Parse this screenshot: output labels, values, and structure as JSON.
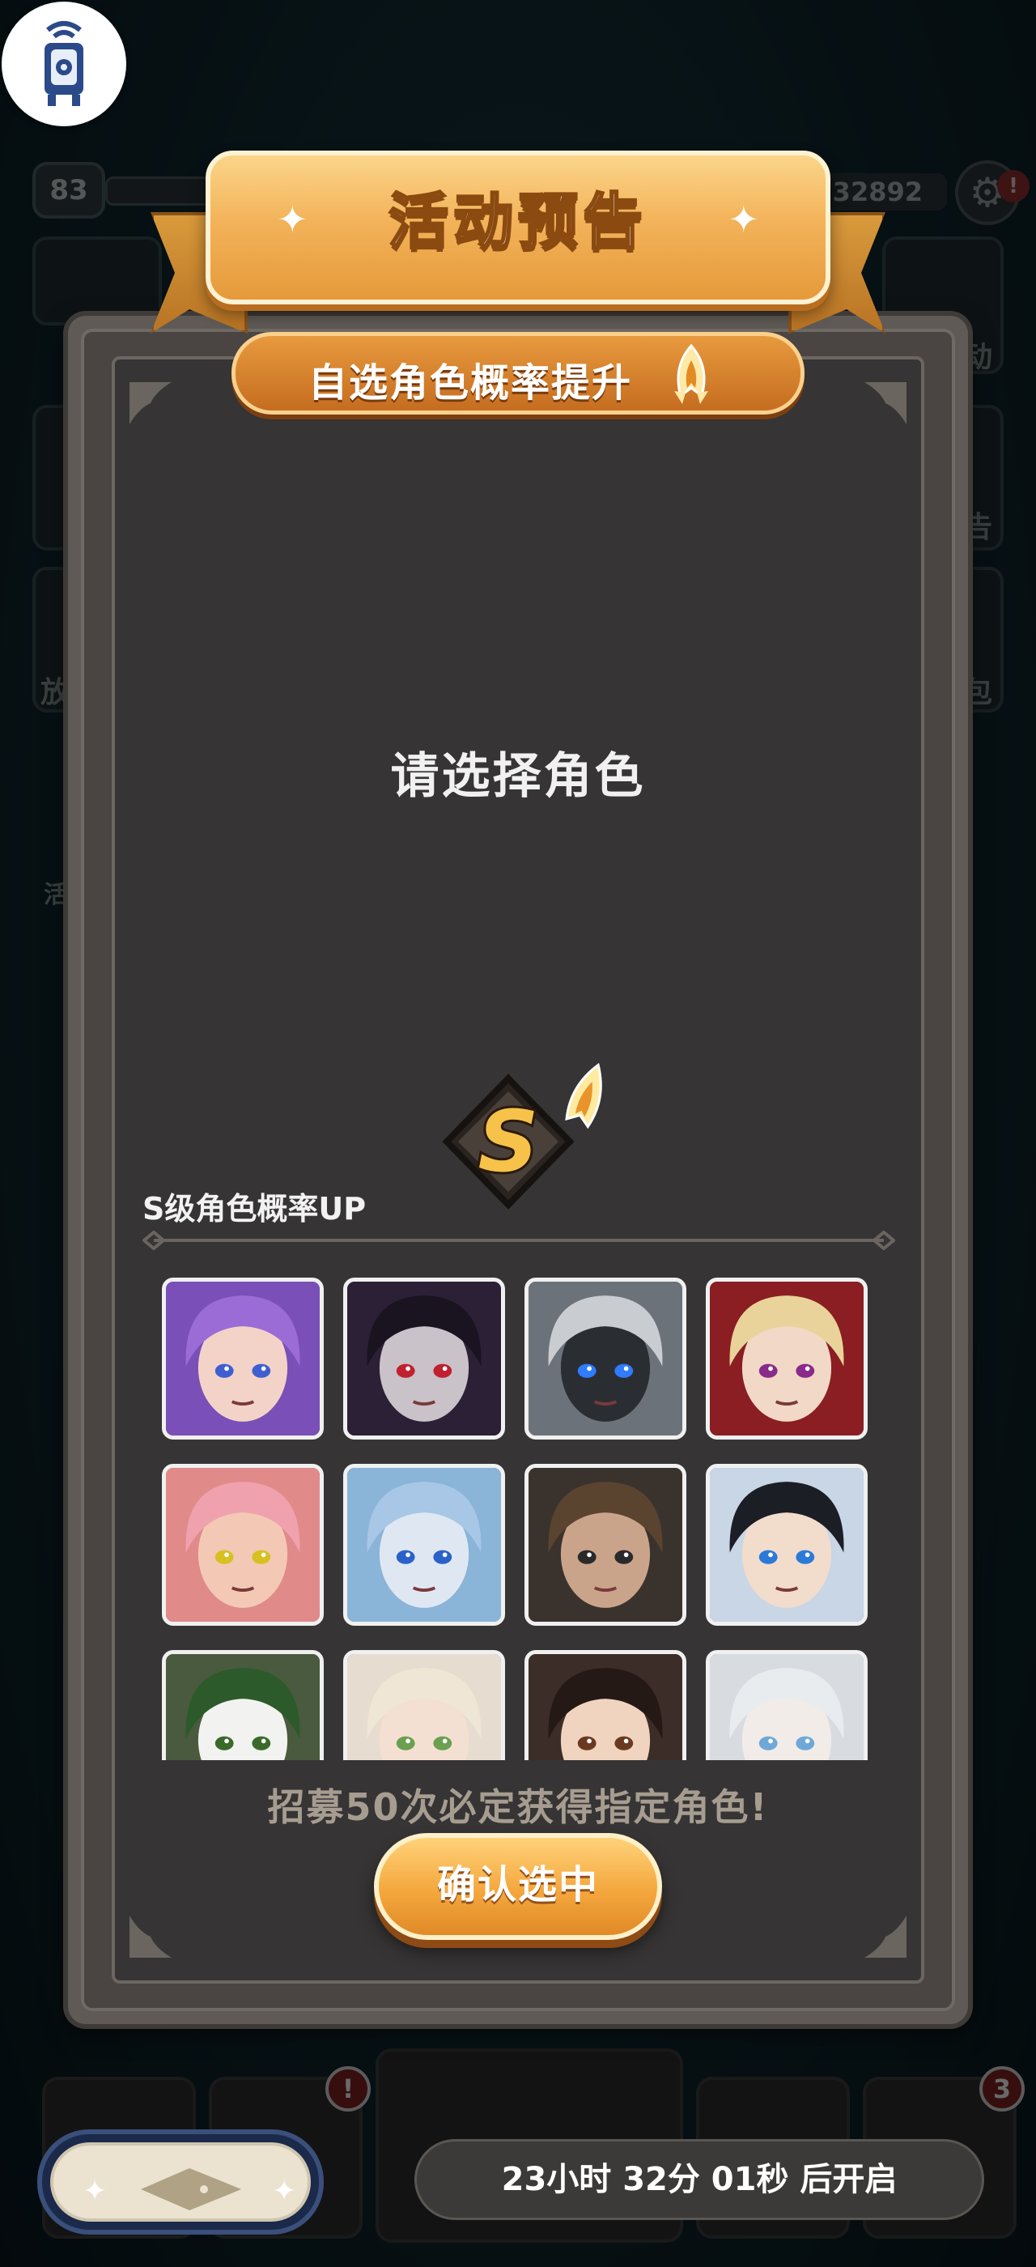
{
  "background": {
    "level": "83",
    "coins": "32892",
    "settings_badge": "!",
    "side_labels": [
      "动",
      "告",
      "包",
      "放",
      "活"
    ],
    "bottom_badges": [
      "!",
      "3"
    ]
  },
  "event": {
    "title": "活动预告",
    "subtitle": "自选角色概率提升",
    "prompt": "请选择角色",
    "rank_letter": "S",
    "rank_label": "S级角色概率UP",
    "guarantee_text": "招募50次必定获得指定角色!",
    "confirm_label": "确认选中",
    "countdown": "23小时 32分 01秒 后开启"
  },
  "characters": [
    {
      "id": "purple-hair-girl",
      "bg": "#7a4fb8",
      "hair": "#9b6cd6",
      "skin": "#f3d3c8",
      "eye": "#3f5fd0"
    },
    {
      "id": "dark-masked-villain",
      "bg": "#2b2035",
      "hair": "#1a1320",
      "skin": "#c9c2c8",
      "eye": "#c02030"
    },
    {
      "id": "robot-knight",
      "bg": "#6c7279",
      "hair": "#c9ccd0",
      "skin": "#2a2e33",
      "eye": "#2f7cff"
    },
    {
      "id": "blonde-elf",
      "bg": "#8a1e22",
      "hair": "#e9d39a",
      "skin": "#f2d8c6",
      "eye": "#8a2a8a"
    },
    {
      "id": "pink-hair-girl",
      "bg": "#e08a8a",
      "hair": "#f0a1ae",
      "skin": "#f3c9b5",
      "eye": "#d8c020"
    },
    {
      "id": "blue-hair-lady",
      "bg": "#8ab4d8",
      "hair": "#a8c6e6",
      "skin": "#dfe8f2",
      "eye": "#2a62c8"
    },
    {
      "id": "bearded-hunter",
      "bg": "#3a332d",
      "hair": "#5a4430",
      "skin": "#caa48a",
      "eye": "#2a2a2a"
    },
    {
      "id": "black-hair-swordsman",
      "bg": "#c8d6e6",
      "hair": "#1c1e26",
      "skin": "#f2dccc",
      "eye": "#2c7ad8"
    },
    {
      "id": "joker-clown",
      "bg": "#4a5a3e",
      "hair": "#2d5a2a",
      "skin": "#f2f2f0",
      "eye": "#3a6a2a"
    },
    {
      "id": "cream-hair-girl",
      "bg": "#e6ddd0",
      "hair": "#efe6d6",
      "skin": "#f4e0d2",
      "eye": "#6aa050"
    },
    {
      "id": "dark-hair-priestess",
      "bg": "#3d2d28",
      "hair": "#241915",
      "skin": "#f0d4c0",
      "eye": "#6a3a20"
    },
    {
      "id": "white-hair-elf",
      "bg": "#d8dce0",
      "hair": "#e9ecef",
      "skin": "#f2ece8",
      "eye": "#6fa8d8"
    }
  ]
}
